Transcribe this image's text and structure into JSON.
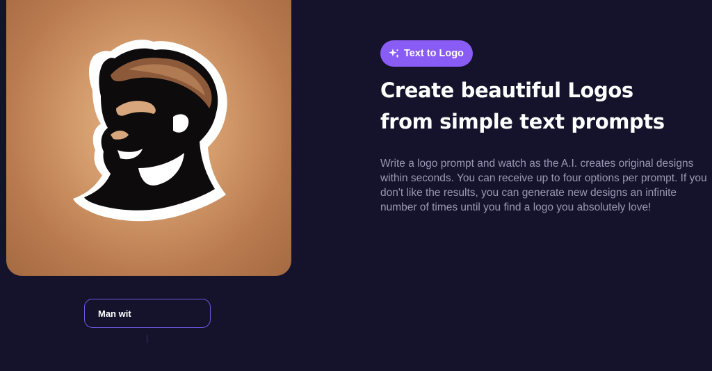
{
  "image": {
    "alt_icon": "bearded-man-logo"
  },
  "prompt": {
    "value": "Man wit"
  },
  "badge": {
    "label": "Text to Logo",
    "icon": "sparkles-icon",
    "color": "#8a5cf6"
  },
  "hero": {
    "headline_line1": "Create beautiful Logos",
    "headline_line2": "from simple text prompts",
    "description": "Write a logo prompt and watch as the A.I. creates original designs within seconds. You can receive up to four options per prompt. If you don't like the results, you can generate new designs an infinite number of times until you find a logo you absolutely love!"
  },
  "colors": {
    "background": "#14132b",
    "accent": "#8a5cf6",
    "input_border": "#6b5ae0",
    "body_text": "#9a98b2"
  }
}
